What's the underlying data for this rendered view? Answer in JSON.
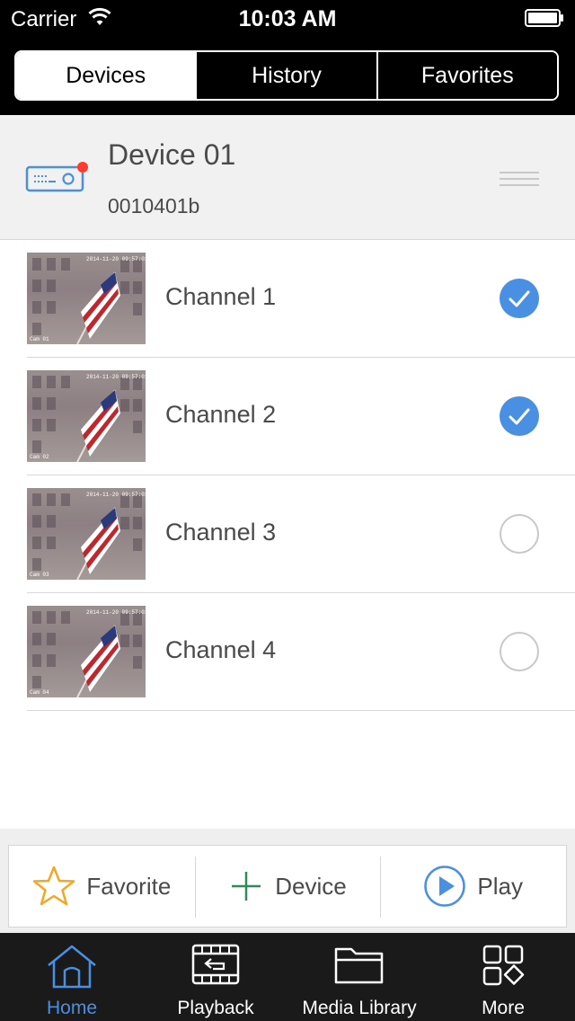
{
  "status_bar": {
    "carrier": "Carrier",
    "time": "10:03 AM"
  },
  "segmented": {
    "tabs": [
      {
        "label": "Devices",
        "active": true
      },
      {
        "label": "History",
        "active": false
      },
      {
        "label": "Favorites",
        "active": false
      }
    ]
  },
  "device": {
    "name": "Device 01",
    "serial": "0010401b",
    "status_dot_color": "#ff3b30"
  },
  "channels": [
    {
      "label": "Channel 1",
      "selected": true,
      "overlay_id": "Cam 01"
    },
    {
      "label": "Channel 2",
      "selected": true,
      "overlay_id": "Cam 02"
    },
    {
      "label": "Channel 3",
      "selected": false,
      "overlay_id": "Cam 03"
    },
    {
      "label": "Channel 4",
      "selected": false,
      "overlay_id": "Cam 04"
    }
  ],
  "actions": {
    "favorite": {
      "label": "Favorite",
      "icon": "star-icon"
    },
    "device": {
      "label": "Device",
      "icon": "plus-icon"
    },
    "play": {
      "label": "Play",
      "icon": "play-circle-icon"
    }
  },
  "tabbar": {
    "items": [
      {
        "label": "Home",
        "icon": "house-icon",
        "active": true
      },
      {
        "label": "Playback",
        "icon": "film-playback-icon",
        "active": false
      },
      {
        "label": "Media Library",
        "icon": "folder-icon",
        "active": false
      },
      {
        "label": "More",
        "icon": "grid-icon",
        "active": false
      }
    ]
  },
  "colors": {
    "accent": "#4a90e2",
    "star": "#f5a623",
    "plus": "#2e8b57",
    "header_bg": "#000000"
  }
}
